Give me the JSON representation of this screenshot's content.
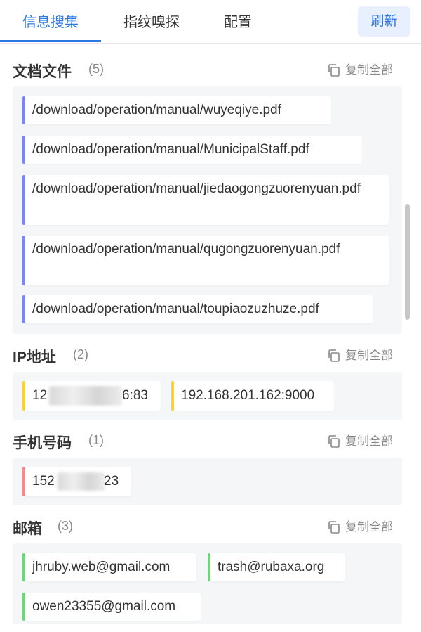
{
  "tabs": [
    {
      "label": "信息搜集"
    },
    {
      "label": "指纹嗅探"
    },
    {
      "label": "配置"
    }
  ],
  "refresh_label": "刷新",
  "copy_all_label": "复制全部",
  "colors": {
    "accent": "#2f7be0",
    "doc_bar": "#7b86f0",
    "ip_bar": "#f7d23a",
    "phone_bar": "#f28b8b",
    "email_bar": "#6fd47a"
  },
  "sections": {
    "docs": {
      "title": "文档文件",
      "count": "(5)",
      "items": [
        "/download/operation/manual/wuyeqiye.pdf",
        "/download/operation/manual/MunicipalStaff.pdf",
        "/download/operation/manual/jiedaogongzuorenyuan.pdf",
        "/download/operation/manual/qugongzuorenyuan.pdf",
        "/download/operation/manual/toupiaozuzhuze.pdf"
      ]
    },
    "ip": {
      "title": "IP地址",
      "count": "(2)",
      "items": [
        {
          "prefix": "12",
          "suffix": "6:83"
        },
        {
          "text": "192.168.201.162:9000"
        }
      ]
    },
    "phone": {
      "title": "手机号码",
      "count": "(1)",
      "items": [
        {
          "prefix": "152",
          "suffix": "23"
        }
      ]
    },
    "email": {
      "title": "邮箱",
      "count": "(3)",
      "items": [
        "jhruby.web@gmail.com",
        "trash@rubaxa.org",
        "owen23355@gmail.com"
      ]
    }
  }
}
